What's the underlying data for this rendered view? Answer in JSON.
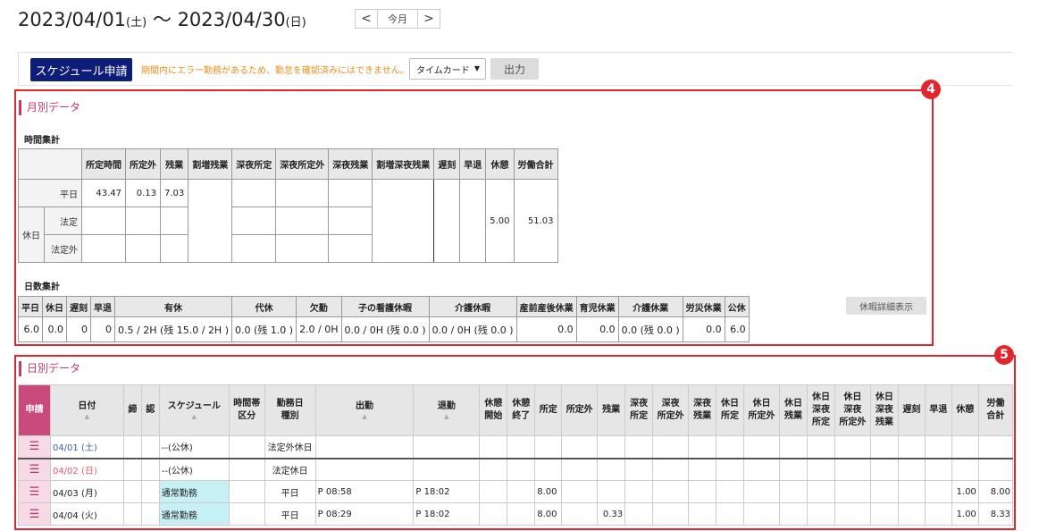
{
  "header": {
    "start_date": "2023/04/01",
    "start_dow": "(土)",
    "tilde": " 〜 ",
    "end_date": "2023/04/30",
    "end_dow": "(日)",
    "prev": "<",
    "current": "今月",
    "next": ">"
  },
  "toolbar": {
    "schedule_request": "スケジュール申請",
    "warning": "期間内にエラー勤務があるため、勤怠を確認済みにはできません。",
    "select_value": "タイムカード",
    "output": "出力"
  },
  "badges": {
    "monthly": "4",
    "daily": "5"
  },
  "monthly": {
    "title": "月別データ",
    "hours_heading": "時間集計",
    "hours_columns": [
      "所定時間",
      "所定外",
      "残業",
      "割増残業",
      "深夜所定",
      "深夜所定外",
      "深夜残業",
      "割増深夜残業",
      "遅刻",
      "早退",
      "休憩",
      "労働合計"
    ],
    "weekday_label": "平日",
    "holiday_label": "休日",
    "legal_label": "法定",
    "nonlegal_label": "法定外",
    "weekday_values": [
      "43.47",
      "0.13",
      "7.03"
    ],
    "break_total": "5.00",
    "work_total": "51.03",
    "days_heading": "日数集計",
    "days_columns": [
      "平日",
      "休日",
      "遅刻",
      "早退",
      "有休",
      "代休",
      "欠勤",
      "子の看護休暇",
      "介護休暇",
      "産前産後休業",
      "育児休業",
      "介護休業",
      "労災休業",
      "公休"
    ],
    "days_values": [
      "6.0",
      "0.0",
      "0",
      "0",
      "0.5 / 2H (残 15.0 / 2H )",
      "0.0 (残 1.0 )",
      "2.0 / 0H",
      "0.0 / 0H (残 0.0 )",
      "0.0 / 0H (残 0.0 )",
      "0.0",
      "0.0",
      "0.0 (残 0.0 )",
      "0.0",
      "6.0"
    ],
    "leave_detail_button": "休暇詳細表示"
  },
  "daily": {
    "title": "日別データ",
    "columns": {
      "request": "申請",
      "date": "日付",
      "close": "締",
      "approve": "認",
      "schedule": "スケジュール",
      "timezone": [
        "時間帯",
        "区分"
      ],
      "daytype": [
        "勤務日",
        "種別"
      ],
      "in": "出勤",
      "out": "退勤",
      "break_start": [
        "休憩",
        "開始"
      ],
      "break_end": [
        "休憩",
        "終了"
      ],
      "scheduled": "所定",
      "overtime_sched": "所定外",
      "overtime": "残業",
      "night_sched": [
        "深夜",
        "所定"
      ],
      "night_over_sched": [
        "深夜",
        "所定外"
      ],
      "night_over": [
        "深夜",
        "残業"
      ],
      "hol_sched": [
        "休日",
        "所定"
      ],
      "hol_over_sched": [
        "休日",
        "所定外"
      ],
      "hol_over": [
        "休日",
        "残業"
      ],
      "hol_night_sched": [
        "休日",
        "深夜",
        "所定"
      ],
      "hol_night_over_sched": [
        "休日",
        "深夜",
        "所定外"
      ],
      "hol_night_over": [
        "休日",
        "深夜",
        "残業"
      ],
      "late": "遅刻",
      "early": "早退",
      "break": "休憩",
      "work_total": [
        "労働",
        "合計"
      ]
    },
    "rows": [
      {
        "date": "04/01 (土)",
        "schedule": "--(公休)",
        "daytype": "法定外休日",
        "in": "",
        "out": "",
        "scheduled": "",
        "overtime": "",
        "break": "",
        "total": ""
      },
      {
        "date": "04/02 (日)",
        "schedule": "--(公休)",
        "daytype": "法定休日",
        "in": "",
        "out": "",
        "scheduled": "",
        "overtime": "",
        "break": "",
        "total": ""
      },
      {
        "date": "04/03 (月)",
        "schedule": "通常勤務",
        "daytype": "平日",
        "in": "P 08:58",
        "out": "P 18:02",
        "scheduled": "8.00",
        "overtime": "",
        "break": "1.00",
        "total": "8.00"
      },
      {
        "date": "04/04 (火)",
        "schedule": "通常勤務",
        "daytype": "平日",
        "in": "P 08:29",
        "out": "P 18:02",
        "scheduled": "8.00",
        "overtime": "0.33",
        "break": "1.00",
        "total": "8.33"
      }
    ]
  }
}
